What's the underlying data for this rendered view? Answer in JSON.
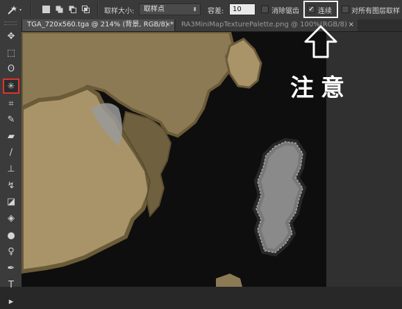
{
  "options_bar": {
    "sample_size_label": "取样大小:",
    "sample_size_value": "取样点",
    "tolerance_label": "容差:",
    "tolerance_value": "10",
    "anti_alias_label": "消除锯齿",
    "contiguous_label": "连续",
    "sample_all_layers_label": "对所有图层取样",
    "contiguous_checked": true,
    "anti_alias_checked": false,
    "sample_all_layers_checked": false
  },
  "tabs": [
    {
      "label": "TGA_720x560.tga @ 214% (背景, RGB/8) *",
      "close": "×",
      "active": true
    },
    {
      "label": "RA3MiniMapTexturePalette.png @ 100%(RGB/8)",
      "close": "×",
      "active": false
    }
  ],
  "toolbar": {
    "tools": [
      {
        "name": "move-tool",
        "icon": "move-icon",
        "glyph": "✥"
      },
      {
        "name": "marquee-tool",
        "icon": "rect-marquee-icon",
        "glyph": "⬚"
      },
      {
        "name": "lasso-tool",
        "icon": "lasso-icon",
        "glyph": "ʘ"
      },
      {
        "name": "magic-wand-tool",
        "icon": "magic-wand-icon",
        "glyph": "✳",
        "selected": true
      },
      {
        "name": "crop-tool",
        "icon": "crop-icon",
        "glyph": "⌗"
      },
      {
        "name": "eyedropper-tool",
        "icon": "eyedropper-icon",
        "glyph": "✎"
      },
      {
        "name": "healing-brush-tool",
        "icon": "bandage-icon",
        "glyph": "▰"
      },
      {
        "name": "brush-tool",
        "icon": "brush-icon",
        "glyph": "∕"
      },
      {
        "name": "clone-stamp-tool",
        "icon": "stamp-icon",
        "glyph": "⊥"
      },
      {
        "name": "history-brush-tool",
        "icon": "history-brush-icon",
        "glyph": "↯"
      },
      {
        "name": "eraser-tool",
        "icon": "eraser-icon",
        "glyph": "◪"
      },
      {
        "name": "paint-bucket-tool",
        "icon": "bucket-icon",
        "glyph": "◈"
      },
      {
        "name": "blur-tool",
        "icon": "drop-icon",
        "glyph": "●"
      },
      {
        "name": "dodge-tool",
        "icon": "dodge-icon",
        "glyph": "♀"
      },
      {
        "name": "pen-tool",
        "icon": "pen-icon",
        "glyph": "✒"
      },
      {
        "name": "type-tool",
        "icon": "type-icon",
        "glyph": "T"
      },
      {
        "name": "path-selection-tool",
        "icon": "path-select-icon",
        "glyph": "▸"
      }
    ]
  },
  "annotation": {
    "text": "注意",
    "arrow": "up-arrow",
    "color": "#ffffff"
  },
  "colors": {
    "map_land": "#8c7a55",
    "map_land_outline": "#6b5b38",
    "map_sea": "#0e0e0e",
    "selection_fill": "#8a8a8a",
    "tool_highlight": "#e0342e"
  }
}
